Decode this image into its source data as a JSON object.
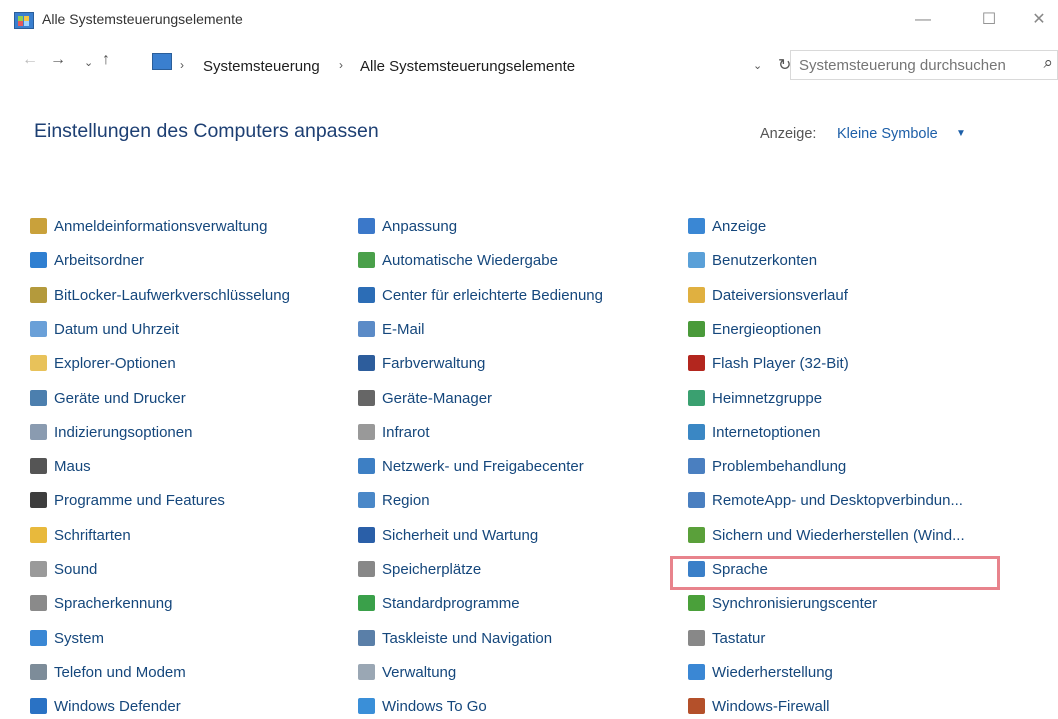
{
  "window": {
    "title": "Alle Systemsteuerungselemente",
    "minimize_glyph": "—",
    "maximize_glyph": "☐",
    "close_glyph": "✕"
  },
  "navigation": {
    "back_glyph": "←",
    "forward_glyph": "→",
    "recent_glyph": "⌄",
    "up_glyph": "↑",
    "breadcrumb": [
      "Systemsteuerung",
      "Alle Systemsteuerungselemente"
    ],
    "breadcrumb_separator": "›",
    "dropdown_glyph": "⌄",
    "refresh_glyph": "↻",
    "search_placeholder": "Systemsteuerung durchsuchen",
    "search_icon_glyph": "⌕"
  },
  "header": {
    "title": "Einstellungen des Computers anpassen",
    "view_label": "Anzeige:",
    "view_value": "Kleine Symbole",
    "view_arrow": "▼"
  },
  "highlighted_item": "Sprache",
  "highlight_color": "#e8838c",
  "columns": [
    [
      {
        "label": "Anmeldeinformationsverwaltung",
        "icon": "credential-icon",
        "color": "#c9a13b"
      },
      {
        "label": "Arbeitsordner",
        "icon": "work-folders-icon",
        "color": "#2f7fd1"
      },
      {
        "label": "BitLocker-Laufwerkverschlüsselung",
        "icon": "bitlocker-icon",
        "color": "#b49a3c"
      },
      {
        "label": "Datum und Uhrzeit",
        "icon": "clock-icon",
        "color": "#6aa0d8"
      },
      {
        "label": "Explorer-Optionen",
        "icon": "folder-options-icon",
        "color": "#e8c25a"
      },
      {
        "label": "Geräte und Drucker",
        "icon": "printer-icon",
        "color": "#4c7fae"
      },
      {
        "label": "Indizierungsoptionen",
        "icon": "indexing-icon",
        "color": "#8a9bb0"
      },
      {
        "label": "Maus",
        "icon": "mouse-icon",
        "color": "#555555"
      },
      {
        "label": "Programme und Features",
        "icon": "programs-icon",
        "color": "#3d3d3d"
      },
      {
        "label": "Schriftarten",
        "icon": "fonts-icon",
        "color": "#e8b93c"
      },
      {
        "label": "Sound",
        "icon": "sound-icon",
        "color": "#9a9a9a"
      },
      {
        "label": "Spracherkennung",
        "icon": "microphone-icon",
        "color": "#8a8a8a"
      },
      {
        "label": "System",
        "icon": "system-icon",
        "color": "#3a87d4"
      },
      {
        "label": "Telefon und Modem",
        "icon": "phone-icon",
        "color": "#7d8c99"
      },
      {
        "label": "Windows Defender",
        "icon": "defender-icon",
        "color": "#2a72c4"
      }
    ],
    [
      {
        "label": "Anpassung",
        "icon": "personalization-icon",
        "color": "#3b78c9"
      },
      {
        "label": "Automatische Wiedergabe",
        "icon": "autoplay-icon",
        "color": "#4aa04a"
      },
      {
        "label": "Center für erleichterte Bedienung",
        "icon": "ease-of-access-icon",
        "color": "#2c6db6"
      },
      {
        "label": "E-Mail",
        "icon": "mail-icon",
        "color": "#5b8bc7"
      },
      {
        "label": "Farbverwaltung",
        "icon": "color-management-icon",
        "color": "#2d5d9c"
      },
      {
        "label": "Geräte-Manager",
        "icon": "device-manager-icon",
        "color": "#666666"
      },
      {
        "label": "Infrarot",
        "icon": "infrared-icon",
        "color": "#999999"
      },
      {
        "label": "Netzwerk- und Freigabecenter",
        "icon": "network-icon",
        "color": "#3d7fc4"
      },
      {
        "label": "Region",
        "icon": "region-icon",
        "color": "#4a88c8"
      },
      {
        "label": "Sicherheit und Wartung",
        "icon": "flag-icon",
        "color": "#2a5fa8"
      },
      {
        "label": "Speicherplätze",
        "icon": "storage-icon",
        "color": "#888888"
      },
      {
        "label": "Standardprogramme",
        "icon": "default-programs-icon",
        "color": "#3aa04a"
      },
      {
        "label": "Taskleiste und Navigation",
        "icon": "taskbar-icon",
        "color": "#5a7fa8"
      },
      {
        "label": "Verwaltung",
        "icon": "admin-tools-icon",
        "color": "#9aa7b4"
      },
      {
        "label": "Windows To Go",
        "icon": "windows-to-go-icon",
        "color": "#3a8fd8"
      }
    ],
    [
      {
        "label": "Anzeige",
        "icon": "display-icon",
        "color": "#3a87d4"
      },
      {
        "label": "Benutzerkonten",
        "icon": "user-accounts-icon",
        "color": "#5aa0d8"
      },
      {
        "label": "Dateiversionsverlauf",
        "icon": "file-history-icon",
        "color": "#e0b040"
      },
      {
        "label": "Energieoptionen",
        "icon": "power-icon",
        "color": "#4a9a3a"
      },
      {
        "label": "Flash Player (32-Bit)",
        "icon": "flash-icon",
        "color": "#b3261e"
      },
      {
        "label": "Heimnetzgruppe",
        "icon": "homegroup-icon",
        "color": "#3aa070"
      },
      {
        "label": "Internetoptionen",
        "icon": "internet-options-icon",
        "color": "#3a87c4"
      },
      {
        "label": "Problembehandlung",
        "icon": "troubleshooting-icon",
        "color": "#4a7fc0"
      },
      {
        "label": "RemoteApp- und Desktopverbindun...",
        "icon": "remoteapp-icon",
        "color": "#4a7fc0"
      },
      {
        "label": "Sichern und Wiederherstellen (Wind...",
        "icon": "backup-icon",
        "color": "#5aa03a"
      },
      {
        "label": "Sprache",
        "icon": "language-icon",
        "color": "#3a7fc8"
      },
      {
        "label": "Synchronisierungscenter",
        "icon": "sync-icon",
        "color": "#4aa03a"
      },
      {
        "label": "Tastatur",
        "icon": "keyboard-icon",
        "color": "#888888"
      },
      {
        "label": "Wiederherstellung",
        "icon": "recovery-icon",
        "color": "#3a87d4"
      },
      {
        "label": "Windows-Firewall",
        "icon": "firewall-icon",
        "color": "#b4502a"
      }
    ]
  ]
}
